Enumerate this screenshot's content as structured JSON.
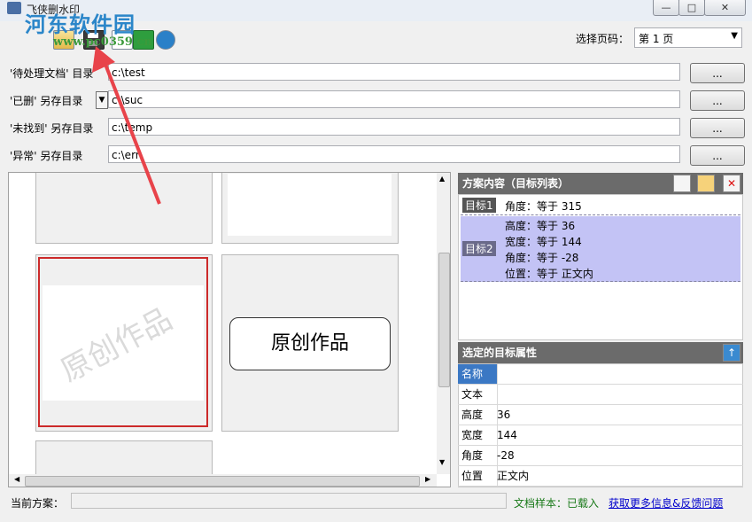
{
  "window": {
    "title": "飞侠删水印",
    "controls": [
      "—",
      "□",
      "✕"
    ]
  },
  "watermark_logo": {
    "name": "河东软件园",
    "url": "www.pc0359.cn"
  },
  "toolbar": {
    "page_label": "选择页码：",
    "page_value": "第 1 页",
    "icons": [
      "open-folder-icon",
      "save-icon",
      "new-document-icon",
      "run-icon",
      "help-icon"
    ]
  },
  "rows": [
    {
      "label": "'待处理文档' 目录",
      "value": "c:\\test",
      "browse": "..."
    },
    {
      "label": "'已删'    另存目录",
      "value": "c:\\suc",
      "browse": "..."
    },
    {
      "label": "'未找到' 另存目录",
      "value": "c:\\temp",
      "browse": "..."
    },
    {
      "label": "'异常'    另存目录",
      "value": "c:\\err",
      "browse": "..."
    }
  ],
  "preview": {
    "thumb_watermark": "原创作品",
    "thumb_box_text": "原创作品"
  },
  "scheme": {
    "header": "方案内容（目标列表）",
    "targets": [
      {
        "tag": "目标1",
        "lines": [
          "角度：等于 315"
        ]
      },
      {
        "tag": "目标2",
        "lines": [
          "高度：等于 36",
          "宽度：等于 144",
          "角度：等于 -28",
          "位置：等于 正文内"
        ]
      }
    ]
  },
  "properties": {
    "header": "选定的目标属性",
    "rows": [
      {
        "key": "名称",
        "value": ""
      },
      {
        "key": "文本",
        "value": ""
      },
      {
        "key": "高度",
        "value": "36"
      },
      {
        "key": "宽度",
        "value": "144"
      },
      {
        "key": "角度",
        "value": "-28"
      },
      {
        "key": "位置",
        "value": "正文内"
      }
    ]
  },
  "status": {
    "current_label": "当前方案：",
    "current_value": "",
    "sample": "文档样本：已载入",
    "link": "获取更多信息&反馈问题"
  },
  "colors": {
    "panel_head": "#6b6b6b",
    "selected_target": "#c3c3f5",
    "sample_green": "#1a7a1a",
    "link_blue": "#0000cc",
    "arrow_red": "#e8434a"
  }
}
